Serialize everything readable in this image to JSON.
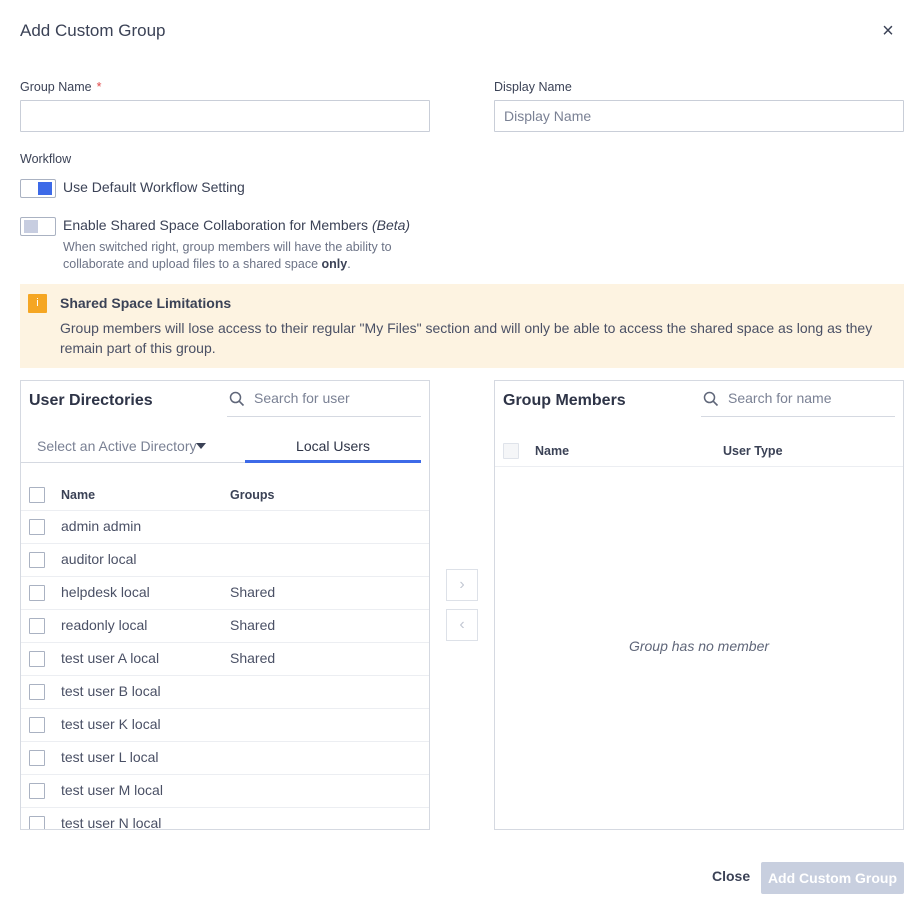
{
  "dialog": {
    "title": "Add Custom Group",
    "close_glyph": "×"
  },
  "form": {
    "group_name_label": "Group Name",
    "required_mark": "*",
    "group_name_value": "",
    "display_name_label": "Display Name",
    "display_name_placeholder": "Display Name",
    "workflow_label": "Workflow",
    "toggle_default_label": "Use Default Workflow Setting",
    "toggle_default_state": "on",
    "toggle_shared_label": "Enable Shared Space Collaboration for Members",
    "toggle_shared_beta": "(Beta)",
    "toggle_shared_state": "off",
    "shared_help_1": "When switched right, group members will have the ability to",
    "shared_help_2": "collaborate and upload files to a shared space",
    "shared_help_bold": "only",
    "shared_help_end": "."
  },
  "banner": {
    "icon": "info-icon",
    "icon_glyph": "i",
    "title": "Shared Space Limitations",
    "text": "Group members will lose access to their regular \"My Files\" section and will only be able to access the shared space as long as they remain part of this group."
  },
  "user_directories": {
    "title": "User Directories",
    "search_placeholder": "Search for user",
    "directory_select": "Select an Active Directory",
    "tab_local": "Local Users",
    "col_name": "Name",
    "col_groups": "Groups",
    "rows": [
      {
        "name": "admin admin",
        "groups": ""
      },
      {
        "name": "auditor local",
        "groups": ""
      },
      {
        "name": "helpdesk local",
        "groups": "Shared"
      },
      {
        "name": "readonly local",
        "groups": "Shared"
      },
      {
        "name": "test user A local",
        "groups": "Shared"
      },
      {
        "name": "test user B local",
        "groups": ""
      },
      {
        "name": "test user K local",
        "groups": ""
      },
      {
        "name": "test user L local",
        "groups": ""
      },
      {
        "name": "test user M local",
        "groups": ""
      },
      {
        "name": "test user N local",
        "groups": ""
      }
    ]
  },
  "transfer": {
    "add_glyph": "›",
    "remove_glyph": "‹"
  },
  "group_members": {
    "title": "Group Members",
    "search_placeholder": "Search for name",
    "col_name": "Name",
    "col_user_type": "User Type",
    "empty_text": "Group has no member"
  },
  "footer": {
    "close_label": "Close",
    "add_label": "Add Custom Group"
  },
  "colors": {
    "accent": "#3d6ae8",
    "banner_bg": "#fdf3e1",
    "banner_icon": "#f5a623",
    "required": "#e04848",
    "disabled_button": "#c8cfdf"
  }
}
